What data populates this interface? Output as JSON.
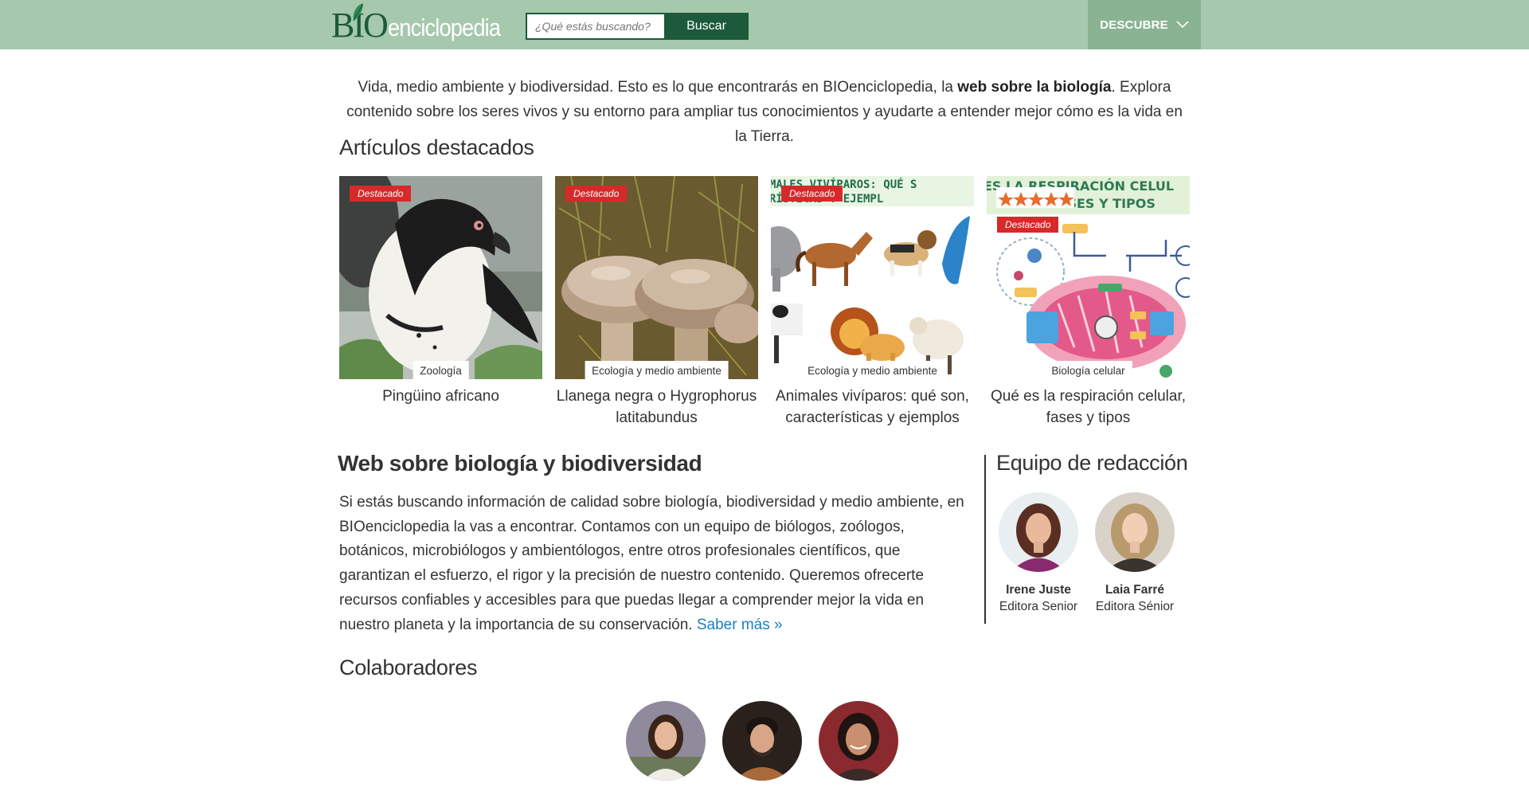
{
  "header": {
    "logo_bio": "BIO",
    "logo_rest": "enciclopedia",
    "search_placeholder": "¿Qué estás buscando?",
    "search_button": "Buscar",
    "discover_label": "DESCUBRE"
  },
  "intro": {
    "part1": "Vida, medio ambiente y biodiversidad. Esto es lo que encontrarás en BIOenciclopedia, la ",
    "bold": "web sobre la biología",
    "part2": ". Explora contenido sobre los seres vivos y su entorno para ampliar tus conocimientos y ayudarte a entender mejor cómo es la vida en la Tierra."
  },
  "featured": {
    "heading": "Artículos destacados",
    "articles": [
      {
        "badge": "Destacado",
        "category": "Zoología",
        "title": "Pingüino africano"
      },
      {
        "badge": "Destacado",
        "category": "Ecología y medio ambiente",
        "title": "Llanega negra o Hygrophorus latitabundus"
      },
      {
        "badge": "Destacado",
        "category": "Ecología y medio ambiente",
        "title": "Animales vivíparos: qué son, características y ejemplos",
        "image_text_1": "MALES VIVÍPAROS: QUÉ S",
        "image_text_2": "RÍSTICAS Y EJEMPL"
      },
      {
        "badge": "Destacado",
        "category": "Biología celular",
        "title": "Qué es la respiración celular, fases y tipos",
        "image_text_1": "ES LA RESPIRACIÓN CELUL",
        "image_text_2": "FASES Y TIPOS"
      }
    ]
  },
  "web": {
    "heading": "Web sobre biología y biodiversidad",
    "text": "Si estás buscando información de calidad sobre biología, biodiversidad y medio ambiente, en BIOenciclopedia la vas a encontrar. Contamos con un equipo de biólogos, zoólogos, botánicos, microbiólogos y ambientólogos, entre otros profesionales científicos, que garantizan el esfuerzo, el rigor y la precisión de nuestro contenido. Queremos ofrecerte recursos confiables y accesibles para que puedas llegar a comprender mejor la vida en nuestro planeta y la importancia de su conservación. ",
    "link": "Saber más »"
  },
  "team": {
    "heading": "Equipo de redacción",
    "members": [
      {
        "name": "Irene Juste",
        "role": "Editora Senior"
      },
      {
        "name": "Laia Farré",
        "role": "Editora Sénior"
      }
    ]
  },
  "collaborators": {
    "heading": "Colaboradores"
  },
  "colors": {
    "header_bg": "#a6c8ac",
    "brand_green": "#1c5a3b",
    "discover_bg": "#8ab393",
    "badge_red": "#d62a2a",
    "link_blue": "#1a7fc1"
  },
  "icons": {
    "discover": "chevron-down-icon"
  }
}
